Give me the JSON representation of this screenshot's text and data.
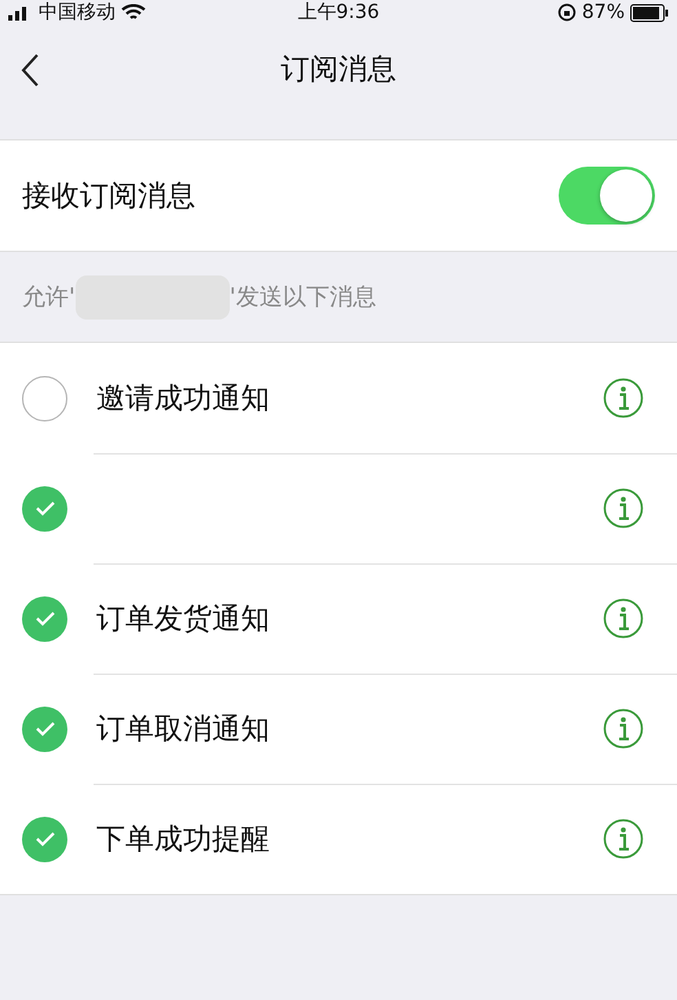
{
  "status_bar": {
    "carrier": "中国移动",
    "time": "上午9:36",
    "battery": "87%"
  },
  "nav": {
    "title": "订阅消息"
  },
  "receive": {
    "label": "接收订阅消息",
    "on": true
  },
  "section": {
    "prefix": "允许'",
    "suffix": "'发送以下消息"
  },
  "items": [
    {
      "label": "邀请成功通知",
      "checked": false
    },
    {
      "checked": true
    },
    {
      "label": "订单发货通知",
      "checked": true
    },
    {
      "label": "订单取消通知",
      "checked": true
    },
    {
      "label": "下单成功提醒",
      "checked": true
    }
  ]
}
